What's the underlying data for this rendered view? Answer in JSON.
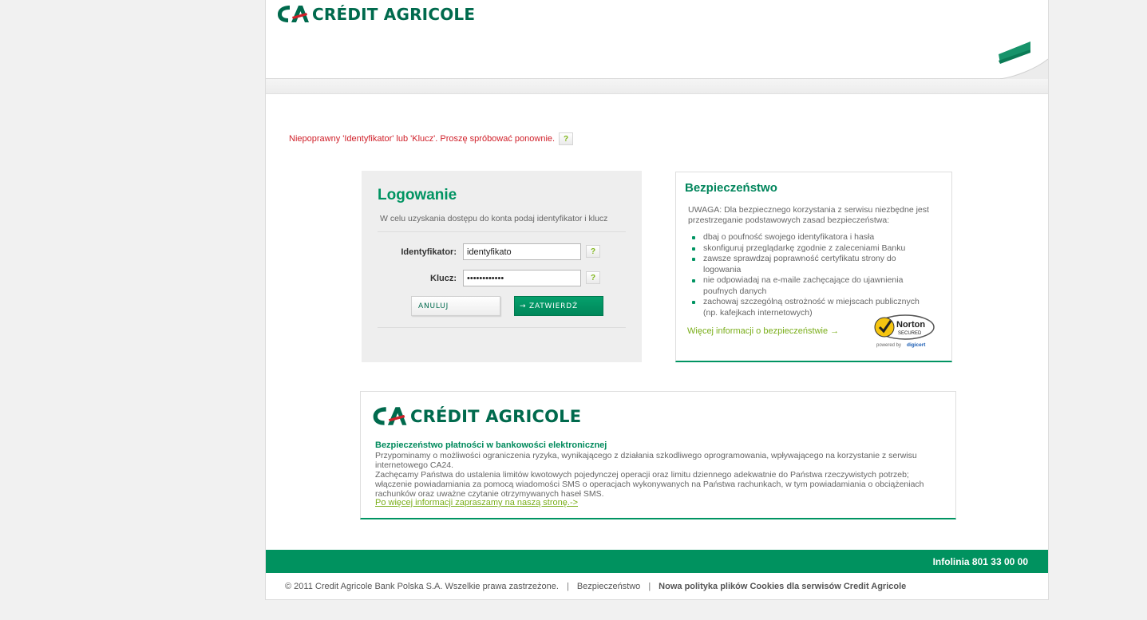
{
  "brand": {
    "logo_text": "CRÉDIT AGRICOLE",
    "primary_color": "#009462",
    "dark_green": "#006a4d",
    "accent_red": "#d0202a"
  },
  "error": {
    "message": "Niepoprawny 'Identyfikator' lub 'Klucz'. Proszę spróbować ponownie.",
    "help_label": "?"
  },
  "login": {
    "title": "Logowanie",
    "subtitle": "W celu uzyskania dostępu do konta podaj identyfikator i klucz",
    "identifier_label": "Identyfikator:",
    "identifier_value": "identyfikato",
    "key_label": "Klucz:",
    "key_value": "••••••••••••",
    "help_label": "?",
    "cancel_label": "ANULUJ",
    "submit_label": "→  ZATWIERDŹ"
  },
  "security": {
    "title": "Bezpieczeństwo",
    "intro": "UWAGA: Dla bezpiecznego korzystania z serwisu niezbędne jest przestrzeganie podstawowych zasad bezpieczeństwa:",
    "items": [
      "dbaj o poufność swojego identyfikatora i hasła",
      "skonfiguruj przeglądarkę zgodnie z zaleceniami Banku",
      "zawsze sprawdzaj poprawność certyfikatu strony do logowania",
      "nie odpowiadaj na e-maile zachęcające do ujawnienia poufnych danych",
      "zachowaj szczególną ostrożność w miejscach publicznych (np. kafejkach internetowych)"
    ],
    "more_link": "Więcej informacji o bezpieczeństwie →",
    "norton": {
      "name": "Norton",
      "secured": "SECURED",
      "powered": "powered by",
      "digicert": "digicert"
    }
  },
  "payments": {
    "title": "Bezpieczeństwo płatności w bankowości elektronicznej",
    "paragraph1": "Przypominamy o możliwości ograniczenia ryzyka, wynikającego z działania szkodliwego oprogramowania, wpływającego na korzystanie z serwisu internetowego CA24.",
    "paragraph2": "Zachęcamy Państwa do ustalenia limitów kwotowych pojedynczej operacji oraz limitu dziennego adekwatnie do Państwa rzeczywistych potrzeb; włączenie powiadamiania za pomocą wiadomości SMS o operacjach wykonywanych na Państwa rachunkach, w tym powiadamiania o obciążeniach rachunków oraz uważne czytanie otrzymywanych haseł SMS.",
    "link": "Po więcej informacji zapraszamy na naszą stronę.->"
  },
  "footer": {
    "infolinia": "Infolinia 801 33 00 00",
    "copyright": "© 2011 Credit Agricole Bank Polska S.A. Wszelkie prawa zastrzeżone.",
    "separator": "|",
    "security_link": "Bezpieczeństwo",
    "cookies_link": "Nowa polityka plików Cookies dla serwisów Credit Agricole"
  }
}
